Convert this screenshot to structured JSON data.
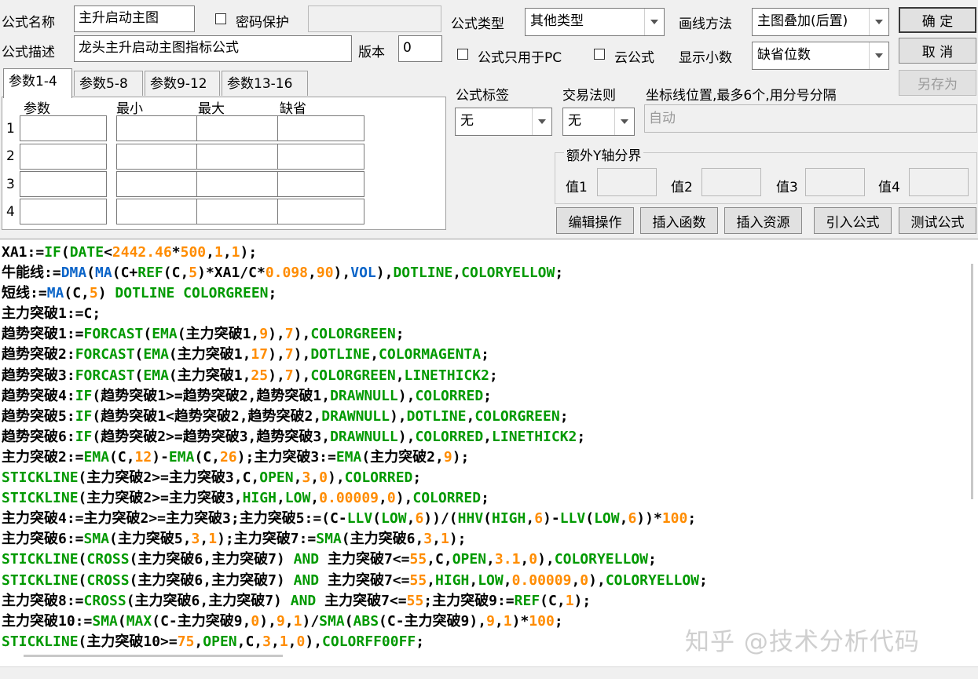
{
  "form": {
    "name_label": "公式名称",
    "name_value": "主升启动主图",
    "password_label": "密码保护",
    "password_value": "",
    "desc_label": "公式描述",
    "desc_value": "龙头主升启动主图指标公式",
    "version_label": "版本",
    "version_value": "0",
    "type_label": "公式类型",
    "type_value": "其他类型",
    "draw_label": "画线方法",
    "draw_value": "主图叠加(后置)",
    "pc_only_label": "公式只用于PC",
    "cloud_label": "云公式",
    "decimals_label": "显示小数",
    "decimals_value": "缺省位数",
    "tag_label": "公式标签",
    "tag_value": "无",
    "rule_label": "交易法则",
    "rule_value": "无",
    "axis_label": "坐标线位置,最多6个,用分号分隔",
    "axis_value": "自动",
    "extra_y_label": "额外Y轴分界",
    "val1": "值1",
    "val2": "值2",
    "val3": "值3",
    "val4": "值4"
  },
  "buttons": {
    "ok": "确  定",
    "cancel": "取  消",
    "save_as": "另存为",
    "edit_op": "编辑操作",
    "insert_func": "插入函数",
    "insert_res": "插入资源",
    "import_formula": "引入公式",
    "test_formula": "测试公式"
  },
  "tabs": [
    "参数1-4",
    "参数5-8",
    "参数9-12",
    "参数13-16"
  ],
  "params": {
    "headers": [
      "参数",
      "最小",
      "最大",
      "缺省"
    ],
    "rows": [
      "1",
      "2",
      "3",
      "4"
    ]
  },
  "code_lines": [
    [
      [
        "k",
        "XA1:="
      ],
      [
        "g",
        "IF"
      ],
      [
        "k",
        "("
      ],
      [
        "g",
        "DATE"
      ],
      [
        "k",
        "<"
      ],
      [
        "o",
        "2442.46"
      ],
      [
        "k",
        "*"
      ],
      [
        "o",
        "500"
      ],
      [
        "k",
        ","
      ],
      [
        "o",
        "1"
      ],
      [
        "k",
        ","
      ],
      [
        "o",
        "1"
      ],
      [
        "k",
        ");"
      ]
    ],
    [
      [
        "k",
        "牛能线:="
      ],
      [
        "b",
        "DMA"
      ],
      [
        "k",
        "("
      ],
      [
        "b",
        "MA"
      ],
      [
        "k",
        "(C+"
      ],
      [
        "g",
        "REF"
      ],
      [
        "k",
        "(C,"
      ],
      [
        "o",
        "5"
      ],
      [
        "k",
        ")*XA1/C*"
      ],
      [
        "o",
        "0.098"
      ],
      [
        "k",
        ","
      ],
      [
        "o",
        "90"
      ],
      [
        "k",
        "),"
      ],
      [
        "b",
        "VOL"
      ],
      [
        "k",
        "),"
      ],
      [
        "g",
        "DOTLINE"
      ],
      [
        "k",
        ","
      ],
      [
        "g",
        "COLORYELLOW"
      ],
      [
        "k",
        ";"
      ]
    ],
    [
      [
        "k",
        "短线:="
      ],
      [
        "b",
        "MA"
      ],
      [
        "k",
        "(C,"
      ],
      [
        "o",
        "5"
      ],
      [
        "k",
        ") "
      ],
      [
        "g",
        "DOTLINE COLORGREEN"
      ],
      [
        "k",
        ";"
      ]
    ],
    [
      [
        "k",
        "主力突破1:=C;"
      ]
    ],
    [
      [
        "k",
        "趋势突破1:="
      ],
      [
        "g",
        "FORCAST"
      ],
      [
        "k",
        "("
      ],
      [
        "g",
        "EMA"
      ],
      [
        "k",
        "(主力突破1,"
      ],
      [
        "o",
        "9"
      ],
      [
        "k",
        "),"
      ],
      [
        "o",
        "7"
      ],
      [
        "k",
        "),"
      ],
      [
        "g",
        "COLORGREEN"
      ],
      [
        "k",
        ";"
      ]
    ],
    [
      [
        "k",
        "趋势突破2:"
      ],
      [
        "g",
        "FORCAST"
      ],
      [
        "k",
        "("
      ],
      [
        "g",
        "EMA"
      ],
      [
        "k",
        "(主力突破1,"
      ],
      [
        "o",
        "17"
      ],
      [
        "k",
        "),"
      ],
      [
        "o",
        "7"
      ],
      [
        "k",
        "),"
      ],
      [
        "g",
        "DOTLINE"
      ],
      [
        "k",
        ","
      ],
      [
        "g",
        "COLORMAGENTA"
      ],
      [
        "k",
        ";"
      ]
    ],
    [
      [
        "k",
        "趋势突破3:"
      ],
      [
        "g",
        "FORCAST"
      ],
      [
        "k",
        "("
      ],
      [
        "g",
        "EMA"
      ],
      [
        "k",
        "(主力突破1,"
      ],
      [
        "o",
        "25"
      ],
      [
        "k",
        "),"
      ],
      [
        "o",
        "7"
      ],
      [
        "k",
        "),"
      ],
      [
        "g",
        "COLORGREEN"
      ],
      [
        "k",
        ","
      ],
      [
        "g",
        "LINETHICK2"
      ],
      [
        "k",
        ";"
      ]
    ],
    [
      [
        "k",
        "趋势突破4:"
      ],
      [
        "g",
        "IF"
      ],
      [
        "k",
        "(趋势突破1>=趋势突破2,趋势突破1,"
      ],
      [
        "g",
        "DRAWNULL"
      ],
      [
        "k",
        "),"
      ],
      [
        "g",
        "COLORRED"
      ],
      [
        "k",
        ";"
      ]
    ],
    [
      [
        "k",
        "趋势突破5:"
      ],
      [
        "g",
        "IF"
      ],
      [
        "k",
        "(趋势突破1<趋势突破2,趋势突破2,"
      ],
      [
        "g",
        "DRAWNULL"
      ],
      [
        "k",
        "),"
      ],
      [
        "g",
        "DOTLINE"
      ],
      [
        "k",
        ","
      ],
      [
        "g",
        "COLORGREEN"
      ],
      [
        "k",
        ";"
      ]
    ],
    [
      [
        "k",
        "趋势突破6:"
      ],
      [
        "g",
        "IF"
      ],
      [
        "k",
        "(趋势突破2>=趋势突破3,趋势突破3,"
      ],
      [
        "g",
        "DRAWNULL"
      ],
      [
        "k",
        "),"
      ],
      [
        "g",
        "COLORRED"
      ],
      [
        "k",
        ","
      ],
      [
        "g",
        "LINETHICK2"
      ],
      [
        "k",
        ";"
      ]
    ],
    [
      [
        "k",
        "主力突破2:="
      ],
      [
        "g",
        "EMA"
      ],
      [
        "k",
        "(C,"
      ],
      [
        "o",
        "12"
      ],
      [
        "k",
        ")-"
      ],
      [
        "g",
        "EMA"
      ],
      [
        "k",
        "(C,"
      ],
      [
        "o",
        "26"
      ],
      [
        "k",
        ");主力突破3:="
      ],
      [
        "g",
        "EMA"
      ],
      [
        "k",
        "(主力突破2,"
      ],
      [
        "o",
        "9"
      ],
      [
        "k",
        ");"
      ]
    ],
    [
      [
        "g",
        "STICKLINE"
      ],
      [
        "k",
        "(主力突破2>=主力突破3,C,"
      ],
      [
        "g",
        "OPEN"
      ],
      [
        "k",
        ","
      ],
      [
        "o",
        "3"
      ],
      [
        "k",
        ","
      ],
      [
        "o",
        "0"
      ],
      [
        "k",
        "),"
      ],
      [
        "g",
        "COLORRED"
      ],
      [
        "k",
        ";"
      ]
    ],
    [
      [
        "g",
        "STICKLINE"
      ],
      [
        "k",
        "(主力突破2>=主力突破3,"
      ],
      [
        "g",
        "HIGH"
      ],
      [
        "k",
        ","
      ],
      [
        "g",
        "LOW"
      ],
      [
        "k",
        ","
      ],
      [
        "o",
        "0.00009"
      ],
      [
        "k",
        ","
      ],
      [
        "o",
        "0"
      ],
      [
        "k",
        "),"
      ],
      [
        "g",
        "COLORRED"
      ],
      [
        "k",
        ";"
      ]
    ],
    [
      [
        "k",
        "主力突破4:=主力突破2>=主力突破3;主力突破5:=(C-"
      ],
      [
        "g",
        "LLV"
      ],
      [
        "k",
        "("
      ],
      [
        "g",
        "LOW"
      ],
      [
        "k",
        ","
      ],
      [
        "o",
        "6"
      ],
      [
        "k",
        "))/("
      ],
      [
        "g",
        "HHV"
      ],
      [
        "k",
        "("
      ],
      [
        "g",
        "HIGH"
      ],
      [
        "k",
        ","
      ],
      [
        "o",
        "6"
      ],
      [
        "k",
        ")-"
      ],
      [
        "g",
        "LLV"
      ],
      [
        "k",
        "("
      ],
      [
        "g",
        "LOW"
      ],
      [
        "k",
        ","
      ],
      [
        "o",
        "6"
      ],
      [
        "k",
        "))*"
      ],
      [
        "o",
        "100"
      ],
      [
        "k",
        ";"
      ]
    ],
    [
      [
        "k",
        "主力突破6:="
      ],
      [
        "g",
        "SMA"
      ],
      [
        "k",
        "(主力突破5,"
      ],
      [
        "o",
        "3"
      ],
      [
        "k",
        ","
      ],
      [
        "o",
        "1"
      ],
      [
        "k",
        ");主力突破7:="
      ],
      [
        "g",
        "SMA"
      ],
      [
        "k",
        "(主力突破6,"
      ],
      [
        "o",
        "3"
      ],
      [
        "k",
        ","
      ],
      [
        "o",
        "1"
      ],
      [
        "k",
        ");"
      ]
    ],
    [
      [
        "g",
        "STICKLINE"
      ],
      [
        "k",
        "("
      ],
      [
        "g",
        "CROSS"
      ],
      [
        "k",
        "(主力突破6,主力突破7) "
      ],
      [
        "g",
        "AND"
      ],
      [
        "k",
        " 主力突破7<="
      ],
      [
        "o",
        "55"
      ],
      [
        "k",
        ",C,"
      ],
      [
        "g",
        "OPEN"
      ],
      [
        "k",
        ","
      ],
      [
        "o",
        "3.1"
      ],
      [
        "k",
        ","
      ],
      [
        "o",
        "0"
      ],
      [
        "k",
        "),"
      ],
      [
        "g",
        "COLORYELLOW"
      ],
      [
        "k",
        ";"
      ]
    ],
    [
      [
        "g",
        "STICKLINE"
      ],
      [
        "k",
        "("
      ],
      [
        "g",
        "CROSS"
      ],
      [
        "k",
        "(主力突破6,主力突破7) "
      ],
      [
        "g",
        "AND"
      ],
      [
        "k",
        " 主力突破7<="
      ],
      [
        "o",
        "55"
      ],
      [
        "k",
        ","
      ],
      [
        "g",
        "HIGH"
      ],
      [
        "k",
        ","
      ],
      [
        "g",
        "LOW"
      ],
      [
        "k",
        ","
      ],
      [
        "o",
        "0.00009"
      ],
      [
        "k",
        ","
      ],
      [
        "o",
        "0"
      ],
      [
        "k",
        "),"
      ],
      [
        "g",
        "COLORYELLOW"
      ],
      [
        "k",
        ";"
      ]
    ],
    [
      [
        "k",
        "主力突破8:="
      ],
      [
        "g",
        "CROSS"
      ],
      [
        "k",
        "(主力突破6,主力突破7) "
      ],
      [
        "g",
        "AND"
      ],
      [
        "k",
        " 主力突破7<="
      ],
      [
        "o",
        "55"
      ],
      [
        "k",
        ";主力突破9:="
      ],
      [
        "g",
        "REF"
      ],
      [
        "k",
        "(C,"
      ],
      [
        "o",
        "1"
      ],
      [
        "k",
        ");"
      ]
    ],
    [
      [
        "k",
        "主力突破10:="
      ],
      [
        "g",
        "SMA"
      ],
      [
        "k",
        "("
      ],
      [
        "g",
        "MAX"
      ],
      [
        "k",
        "(C-主力突破9,"
      ],
      [
        "o",
        "0"
      ],
      [
        "k",
        "),"
      ],
      [
        "o",
        "9"
      ],
      [
        "k",
        ","
      ],
      [
        "o",
        "1"
      ],
      [
        "k",
        ")/"
      ],
      [
        "g",
        "SMA"
      ],
      [
        "k",
        "("
      ],
      [
        "g",
        "ABS"
      ],
      [
        "k",
        "(C-主力突破9),"
      ],
      [
        "o",
        "9"
      ],
      [
        "k",
        ","
      ],
      [
        "o",
        "1"
      ],
      [
        "k",
        ")*"
      ],
      [
        "o",
        "100"
      ],
      [
        "k",
        ";"
      ]
    ],
    [
      [
        "g",
        "STICKLINE"
      ],
      [
        "k",
        "(主力突破10>="
      ],
      [
        "o",
        "75"
      ],
      [
        "k",
        ","
      ],
      [
        "g",
        "OPEN"
      ],
      [
        "k",
        ",C,"
      ],
      [
        "o",
        "3"
      ],
      [
        "k",
        ","
      ],
      [
        "o",
        "1"
      ],
      [
        "k",
        ","
      ],
      [
        "o",
        "0"
      ],
      [
        "k",
        "),"
      ],
      [
        "g",
        "COLORFF00FF"
      ],
      [
        "k",
        ";"
      ]
    ]
  ],
  "watermark": "知乎 @技术分析代码",
  "colors": {
    "keyword_green": "#009900",
    "func_blue": "#0a64c8",
    "number_orange": "#ff8c00"
  }
}
